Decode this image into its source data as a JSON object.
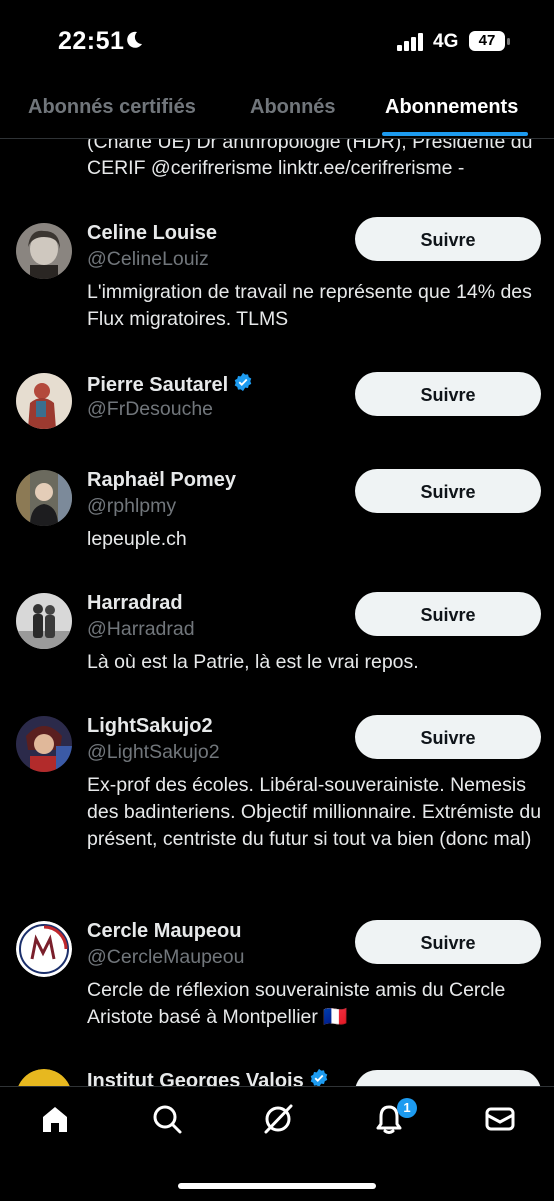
{
  "status_bar": {
    "time": "22:51",
    "network": "4G",
    "battery": "47"
  },
  "tabs": [
    {
      "label": "Abonnés certifiés",
      "active": false
    },
    {
      "label": "Abonnés",
      "active": false
    },
    {
      "label": "Abonnements",
      "active": true
    }
  ],
  "partial_bio": "(Charte UE) Dr anthropologie (HDR), Présidente du CERIF @cerifrerisme linktr.ee/cerifrerisme -",
  "users": [
    {
      "name": "Celine Louise",
      "handle": "@CelineLouiz",
      "verified": false,
      "bio": "L'immigration de travail ne représente que 14% des Flux migratoires. TLMS",
      "follow_label": "Suivre"
    },
    {
      "name": "Pierre Sautarel",
      "handle": "@FrDesouche",
      "verified": true,
      "bio": "",
      "follow_label": "Suivre"
    },
    {
      "name": "Raphaël Pomey",
      "handle": "@rphlpmy",
      "verified": false,
      "bio": "lepeuple.ch",
      "follow_label": "Suivre"
    },
    {
      "name": "Harradrad",
      "handle": "@Harradrad",
      "verified": false,
      "bio": "Là où est la Patrie, là est le vrai repos.",
      "follow_label": "Suivre"
    },
    {
      "name": "LightSakujo2",
      "handle": "@LightSakujo2",
      "verified": false,
      "bio": "Ex-prof des écoles. Libéral-souverainiste. Nemesis des badinteriens. Objectif millionnaire. Extrémiste du présent, centriste du futur si tout va bien (donc mal)",
      "follow_label": "Suivre"
    },
    {
      "name": "Cercle Maupeou",
      "handle": "@CercleMaupeou",
      "verified": false,
      "bio": "Cercle de réflexion souverainiste amis du Cercle Aristote basé à Montpellier 🇫🇷",
      "follow_label": "Suivre"
    },
    {
      "name": "Institut Georges Valois",
      "handle": "",
      "verified": true,
      "bio": "",
      "follow_label": ""
    }
  ],
  "bottom_nav": [
    {
      "icon": "home-icon"
    },
    {
      "icon": "search-icon"
    },
    {
      "icon": "grok-icon"
    },
    {
      "icon": "bell-icon",
      "badge": "1"
    },
    {
      "icon": "mail-icon"
    }
  ],
  "colors": {
    "accent": "#1d9bf0",
    "background": "#000000",
    "secondary_text": "#71767b",
    "button_bg": "#eff3f4"
  }
}
